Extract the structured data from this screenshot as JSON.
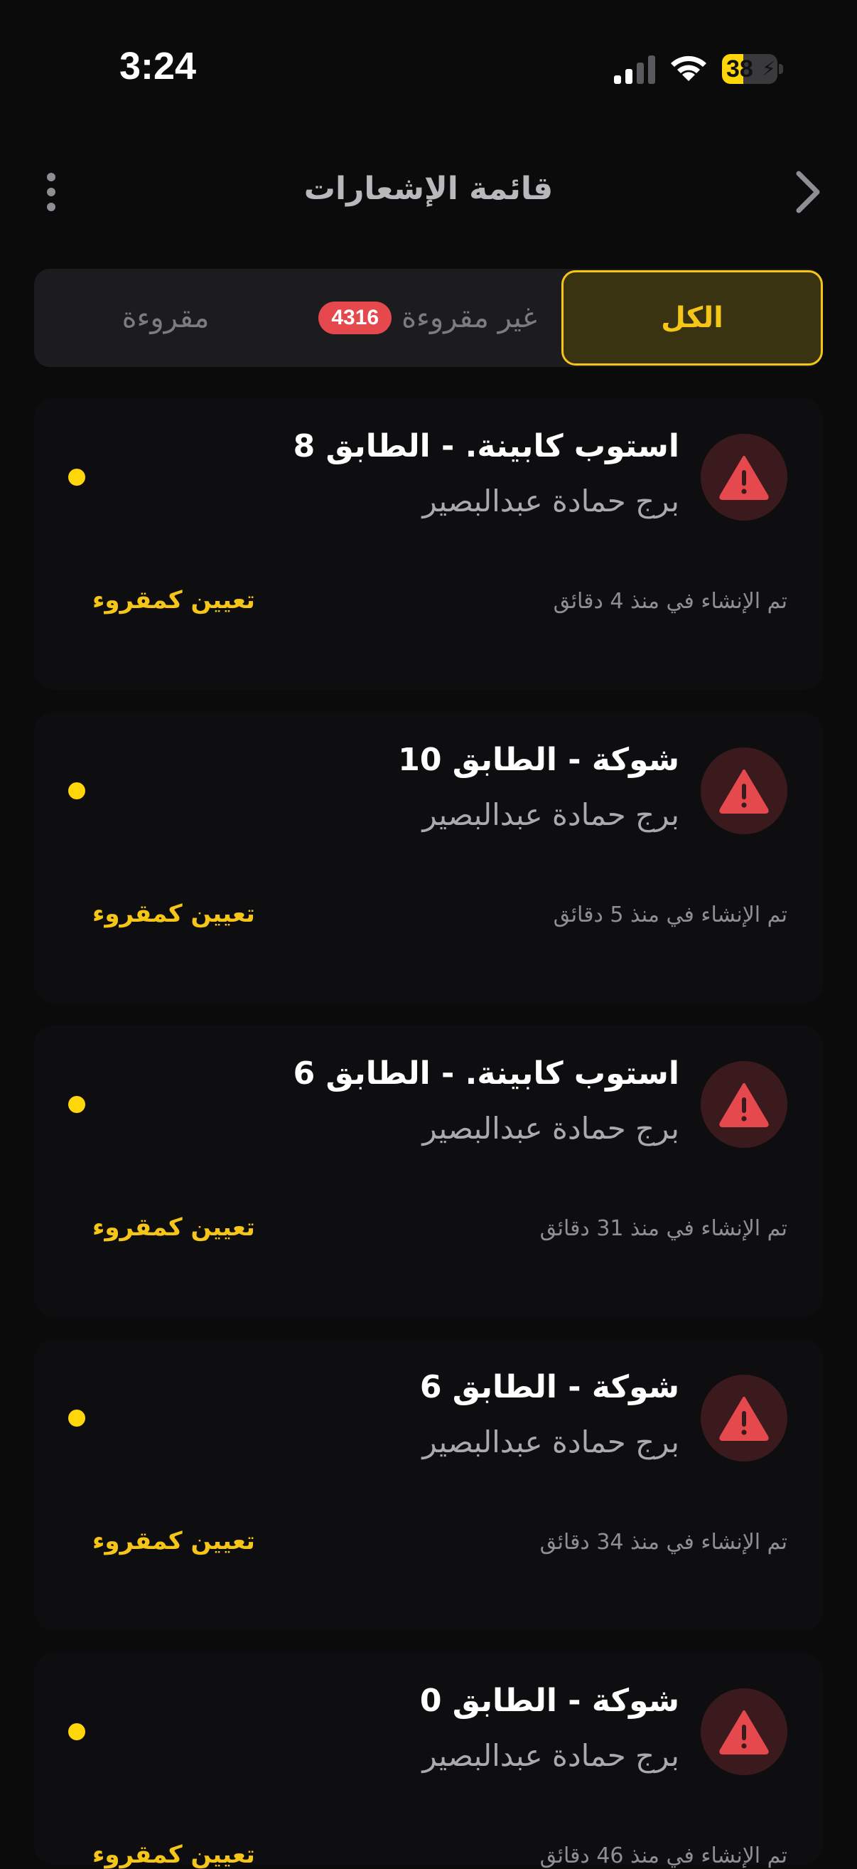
{
  "status_bar": {
    "time": "3:24",
    "battery_level": 38,
    "battery_text": "38",
    "icons": [
      "cellular-signal-icon",
      "wifi-icon",
      "battery-charging-icon"
    ]
  },
  "header": {
    "title": "قائمة الإشعارات",
    "icons": [
      "more-vertical-icon",
      "chevron-right-icon"
    ]
  },
  "tabs": {
    "all": "الكل",
    "unread": "غير مقروءة",
    "unread_count": "4316",
    "read": "مقروءة",
    "selected": "all"
  },
  "notifications": [
    {
      "title": "استوب كابينة. - الطابق 8",
      "subtitle": "برج حمادة عبدالبصير",
      "time": "تم الإنشاء في منذ 4 دقائق",
      "action": "تعيين كمقروء",
      "unread": true
    },
    {
      "title": "شوكة - الطابق 10",
      "subtitle": "برج حمادة عبدالبصير",
      "time": "تم الإنشاء في منذ 5 دقائق",
      "action": "تعيين كمقروء",
      "unread": true
    },
    {
      "title": "استوب كابينة. - الطابق 6",
      "subtitle": "برج حمادة عبدالبصير",
      "time": "تم الإنشاء في منذ 31 دقائق",
      "action": "تعيين كمقروء",
      "unread": true
    },
    {
      "title": "شوكة - الطابق 6",
      "subtitle": "برج حمادة عبدالبصير",
      "time": "تم الإنشاء في منذ 34 دقائق",
      "action": "تعيين كمقروء",
      "unread": true
    },
    {
      "title": "شوكة - الطابق 0",
      "subtitle": "برج حمادة عبدالبصير",
      "time": "تم الإنشاء في منذ 46 دقائق",
      "action": "تعيين كمقروء",
      "unread": true
    }
  ],
  "colors": {
    "accent": "#f5c518",
    "background": "#0b0b0c",
    "alert": "#e5484d",
    "unread_dot": "#ffd60a"
  }
}
